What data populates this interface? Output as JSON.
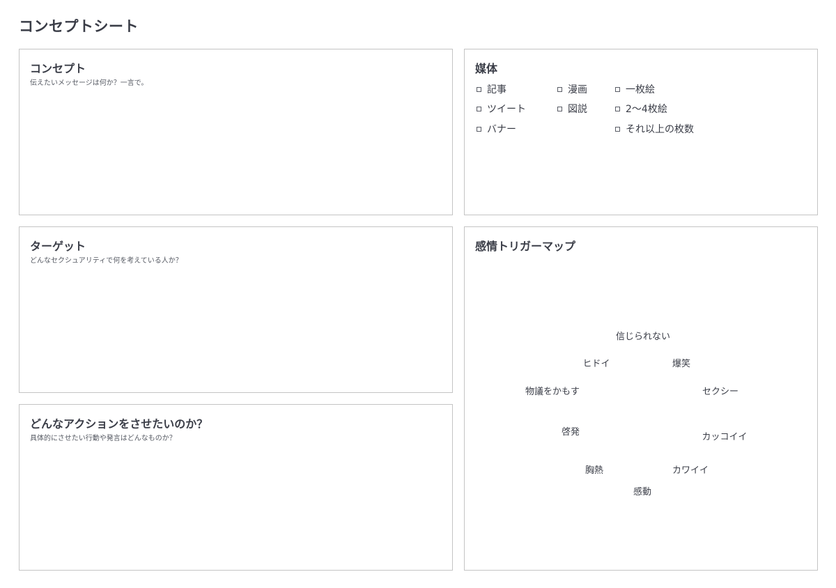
{
  "page": {
    "title": "コンセプトシート"
  },
  "concept": {
    "heading": "コンセプト",
    "subtitle": "伝えたいメッセージは何か？一言で。"
  },
  "target": {
    "heading": "ターゲット",
    "subtitle": "どんなセクシュアリティで何を考えている人か？"
  },
  "action": {
    "heading": "どんなアクションをさせたいのか？",
    "subtitle": "具体的にさせたい行動や発言はどんなものか？"
  },
  "media": {
    "heading": "媒体",
    "options": [
      {
        "label": "記事",
        "checked": false
      },
      {
        "label": "ツイート",
        "checked": false
      },
      {
        "label": "バナー",
        "checked": false
      },
      {
        "label": "漫画",
        "checked": false
      },
      {
        "label": "図説",
        "checked": false
      },
      {
        "label": "一枚絵",
        "checked": false
      },
      {
        "label": "2～4枚絵",
        "checked": false
      },
      {
        "label": "それ以上の枚数",
        "checked": false
      }
    ]
  },
  "emotion_map": {
    "heading": "感情トリガーマップ",
    "words": [
      "信じられない",
      "ヒドイ",
      "爆笑",
      "物議をかもす",
      "セクシー",
      "啓発",
      "カッコイイ",
      "胸熱",
      "カワイイ",
      "感動"
    ]
  },
  "colors": {
    "text": "#3a3d47",
    "border": "#c4c4c4",
    "background": "#ffffff"
  }
}
